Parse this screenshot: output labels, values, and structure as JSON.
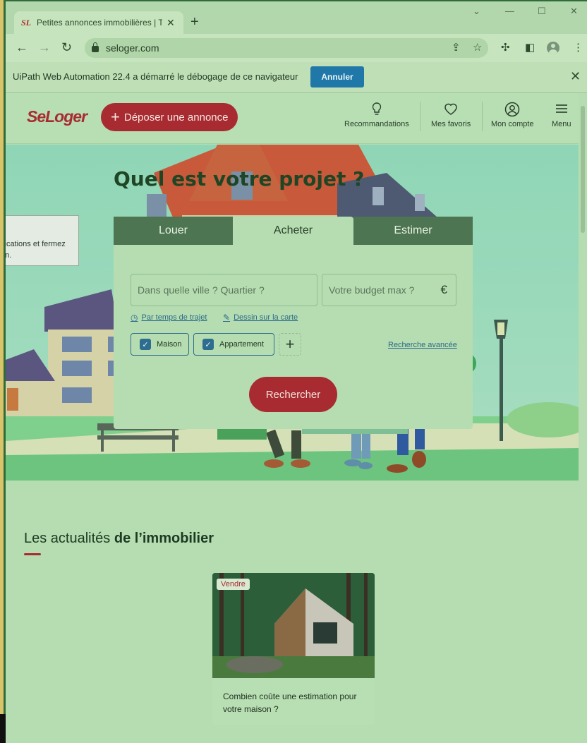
{
  "browser": {
    "tab_favicon": "SL",
    "tab_title": "Petites annonces immobilières | T",
    "tab_close": "✕",
    "new_tab": "+",
    "window_controls": {
      "chevron": "⌄",
      "minimize": "—",
      "maximize": "☐",
      "close": "✕"
    },
    "url": "seloger.com",
    "nav": {
      "back": "←",
      "forward": "→",
      "reload": "↻"
    }
  },
  "infobar": {
    "message": "UiPath Web Automation 22.4 a démarré le débogage de ce navigateur",
    "button": "Annuler",
    "close": "✕"
  },
  "header": {
    "logo": "SeLoger",
    "deposer_plus": "+",
    "deposer_label": "Déposer une annonce",
    "nav": [
      {
        "label": "Recommandations",
        "icon": "lightbulb-icon"
      },
      {
        "label": "Mes favoris",
        "icon": "heart-icon"
      },
      {
        "label": "Mon compte",
        "icon": "user-icon"
      },
      {
        "label": "Menu",
        "icon": "menu-icon"
      }
    ]
  },
  "hero": {
    "title": "Quel est votre projet ?",
    "tabs": [
      "Louer",
      "Acheter",
      "Estimer"
    ],
    "active_tab": "Acheter",
    "city_placeholder": "Dans quelle ville ? Quartier ?",
    "budget_placeholder": "Votre budget max ?",
    "currency": "€",
    "link_trajet": "Par temps de trajet",
    "link_carte": "Dessin sur la carte",
    "chips": [
      {
        "label": "Maison",
        "checked": true
      },
      {
        "label": "Appartement",
        "checked": true
      }
    ],
    "add_chip": "+",
    "advanced_search": "Recherche avancée",
    "search_button": "Rechercher"
  },
  "popup": {
    "line1": "ifications et fermez",
    "line2": "on."
  },
  "news": {
    "title_light": "Les actualités ",
    "title_bold": "de l’immobilier",
    "card": {
      "tag": "Vendre",
      "text": "Combien coûte une estimation pour votre maison ?"
    }
  },
  "colors": {
    "brand_red": "#a82b31",
    "infobar_button": "#1f78a8",
    "checkbox_blue": "#2d6d8f",
    "overlay_green": "#b5ddb1"
  }
}
